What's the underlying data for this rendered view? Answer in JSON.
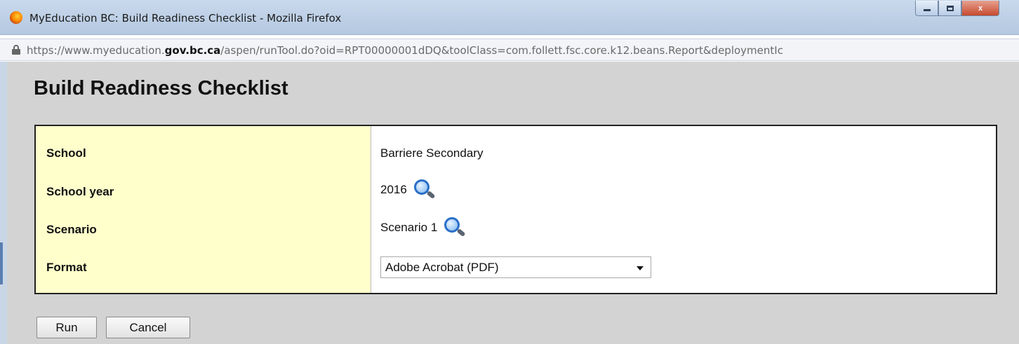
{
  "window": {
    "title": "MyEducation BC: Build Readiness Checklist - Mozilla Firefox",
    "url_prefix": "https://www.myeducation.",
    "url_domain": "gov.bc.ca",
    "url_suffix": "/aspen/runTool.do?oid=RPT00000001dDQ&toolClass=com.follett.fsc.core.k12.beans.Report&deploymentIc",
    "close_label": "x"
  },
  "page": {
    "title": "Build Readiness Checklist"
  },
  "form": {
    "school_label": "School",
    "school_value": "Barriere Secondary",
    "year_label": "School year",
    "year_value": "2016",
    "scenario_label": "Scenario",
    "scenario_value": "Scenario 1",
    "format_label": "Format",
    "format_value": "Adobe Acrobat (PDF)"
  },
  "buttons": {
    "run": "Run",
    "cancel": "Cancel"
  },
  "icons": [
    "firefox-icon",
    "minimize-icon",
    "maximize-icon",
    "close-icon",
    "lock-icon",
    "search-icon",
    "chevron-down-icon"
  ]
}
